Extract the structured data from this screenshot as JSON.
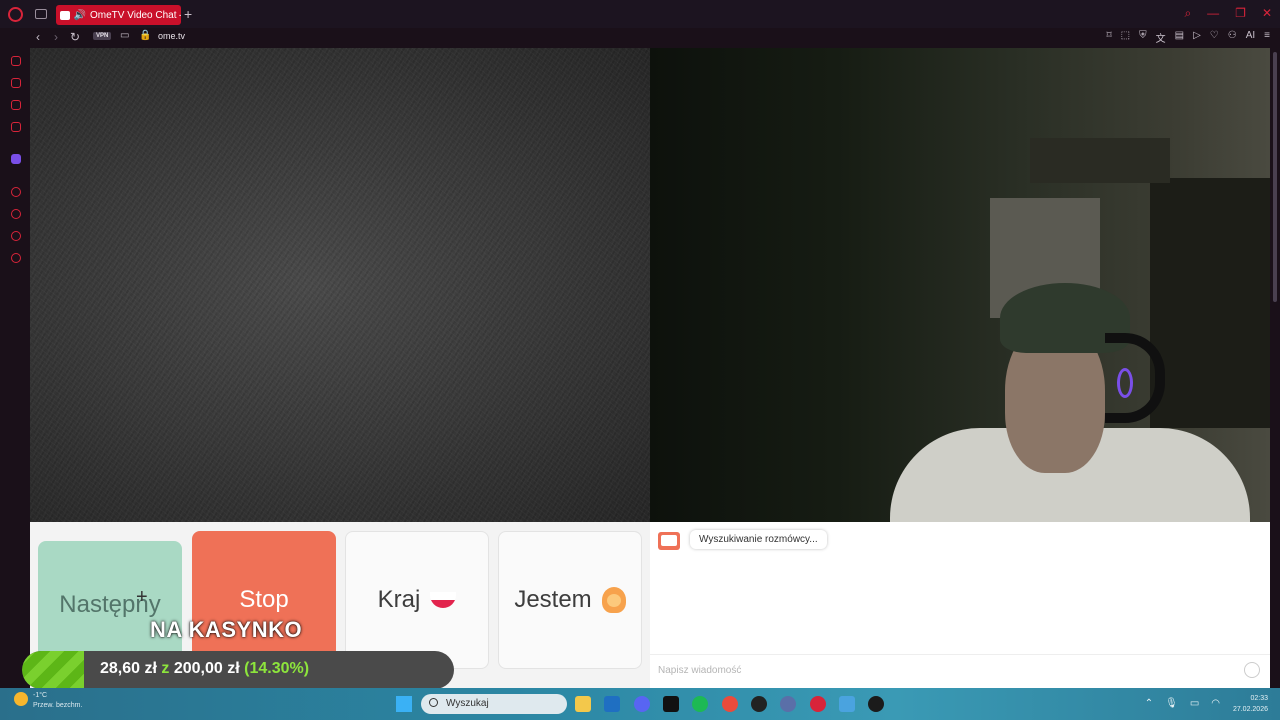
{
  "browser": {
    "tab_title": "OmeTV Video Chat — I",
    "url": "ome.tv",
    "vpn_label": "VPN",
    "ai_label": "AI",
    "sidebar_gx": "GX"
  },
  "controls": {
    "next_label": "Następny",
    "stop_label": "Stop",
    "country_label": "Kraj",
    "gender_label": "Jestem"
  },
  "chat": {
    "status_message": "Wyszukiwanie rozmówcy...",
    "input_placeholder": "Napisz wiadomość"
  },
  "stream_overlay": {
    "headline": "NA KASYNKO",
    "current": "28,60 zł",
    "separator": "z",
    "goal": "200,00 zł",
    "percent_text": "(14.30%)",
    "progress_fraction": 0.143
  },
  "taskbar": {
    "search_placeholder": "Wyszukaj",
    "weather_temp": "-1°C",
    "weather_desc": "Przew. bezchm.",
    "time": "02:33",
    "date": "27.02.2026"
  },
  "colors": {
    "accent": "#c9102a",
    "next_button": "#a9d9c4",
    "stop_button": "#ef7157",
    "progress": "#7ad02e"
  }
}
